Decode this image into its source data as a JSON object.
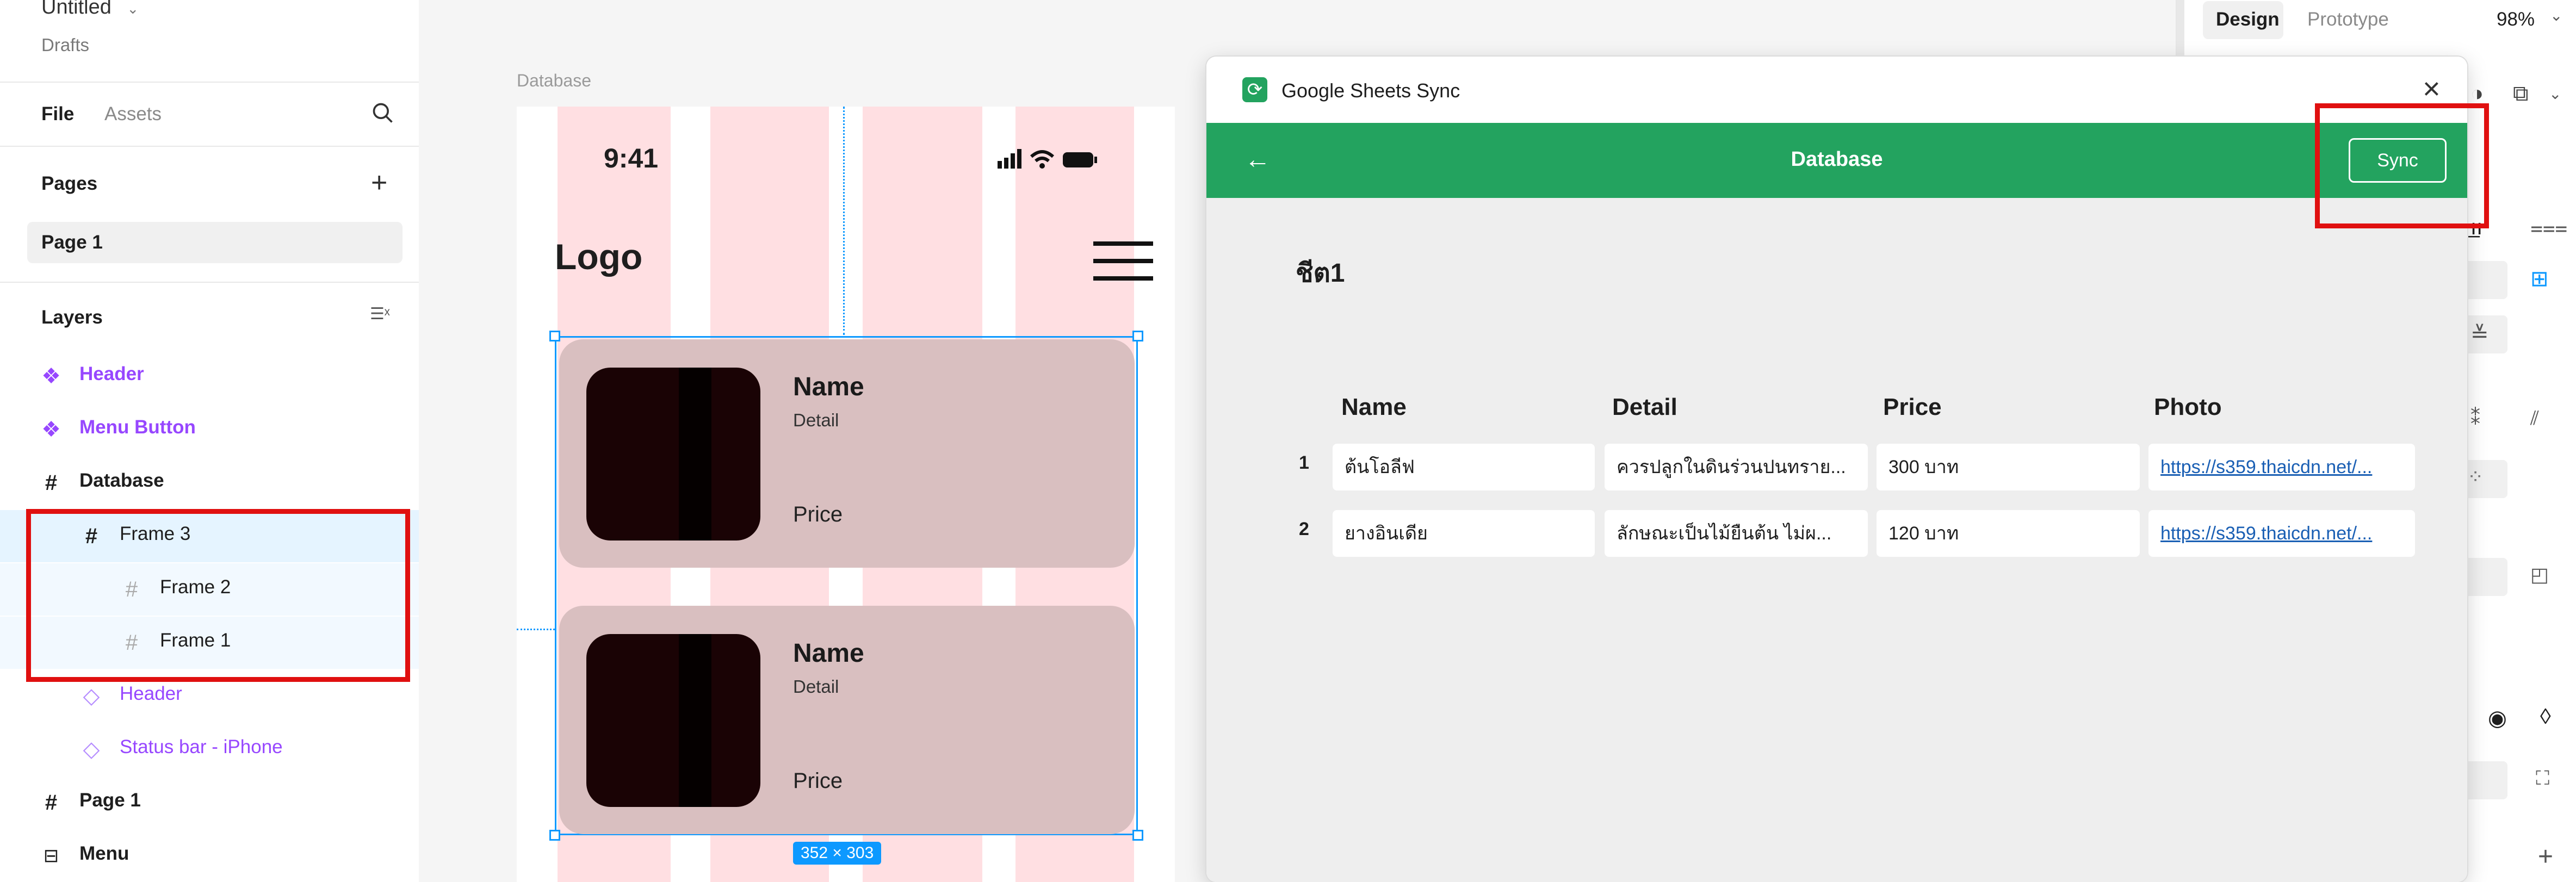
{
  "left_panel": {
    "file_title": "Untitled",
    "file_subtitle": "Drafts",
    "tabs": [
      "File",
      "Assets"
    ],
    "pages_heading": "Pages",
    "current_page": "Page 1",
    "layers_heading": "Layers",
    "layers": [
      {
        "label": "Header",
        "icon": "component-icon"
      },
      {
        "label": "Menu Button",
        "icon": "component-icon"
      },
      {
        "label": "Database",
        "icon": "frame-icon"
      },
      {
        "label": "Frame 3",
        "icon": "frame-icon"
      },
      {
        "label": "Frame 2",
        "icon": "frame-icon"
      },
      {
        "label": "Frame 1",
        "icon": "frame-icon"
      },
      {
        "label": "Header",
        "icon": "instance-icon"
      },
      {
        "label": "Status bar - iPhone",
        "icon": "instance-icon"
      },
      {
        "label": "Page 1",
        "icon": "frame-icon"
      },
      {
        "label": "Menu",
        "icon": "section-icon"
      }
    ]
  },
  "canvas": {
    "frame_label": "Database",
    "status_time": "9:41",
    "logo_text": "Logo",
    "cards": [
      {
        "name": "Name",
        "detail": "Detail",
        "price": "Price"
      },
      {
        "name": "Name",
        "detail": "Detail",
        "price": "Price"
      }
    ],
    "size_badge": "352 × 303"
  },
  "plugin": {
    "title": "Google Sheets Sync",
    "bar_title": "Database",
    "sync_label": "Sync",
    "sheet_name": "ชีต1",
    "columns": [
      "Name",
      "Detail",
      "Price",
      "Photo"
    ],
    "rows": [
      {
        "index": "1",
        "name": "ต้นโอลีฟ",
        "detail": "ควรปลูกในดินร่วนปนทราย...",
        "price": "300 บาท",
        "photo": "https://s359.thaicdn.net/..."
      },
      {
        "index": "2",
        "name": "ยางอินเดีย",
        "detail": "ลักษณะเป็นไม้ยืนต้น ไม่ผ...",
        "price": "120 บาท",
        "photo": "https://s359.thaicdn.net/..."
      }
    ],
    "accent_color": "#23a35f"
  },
  "right_panel": {
    "tabs": [
      "Design",
      "Prototype"
    ],
    "zoom": "98%"
  },
  "highlight_color": "#e01010",
  "selection_color": "#0d99ff"
}
